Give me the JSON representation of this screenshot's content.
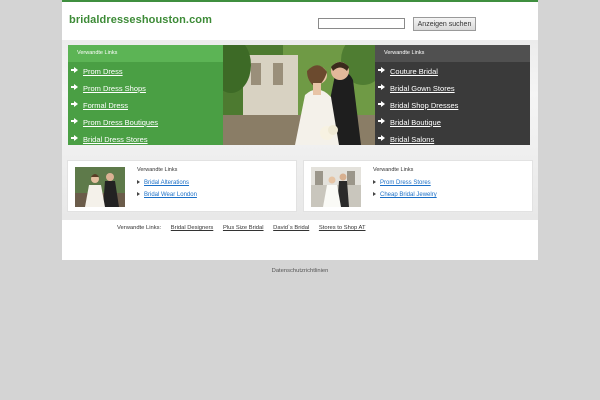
{
  "header": {
    "domain": "bridaldresseshouston.com",
    "search_placeholder": "",
    "search_button": "Anzeigen suchen"
  },
  "left_panel": {
    "heading": "Verwandte Links",
    "links": [
      "Prom Dress",
      "Prom Dress Shops",
      "Formal Dress",
      "Prom Dress Boutiques",
      "Bridal Dress Stores"
    ]
  },
  "right_panel": {
    "heading": "Verwandte Links",
    "links": [
      "Couture Bridal",
      "Bridal Gown Stores",
      "Bridal Shop Dresses",
      "Bridal Boutique",
      "Bridal Salons"
    ]
  },
  "card_left": {
    "heading": "Verwandte Links",
    "links": [
      "Bridal Alterations",
      "Bridal Wear London"
    ]
  },
  "card_right": {
    "heading": "Verwandte Links",
    "links": [
      "Prom Dress Stores",
      "Cheap Bridal Jewelry"
    ]
  },
  "related_bar": {
    "label": "Verwandte Links:",
    "links": [
      "Bridal Designers",
      "Plus Size Bridal",
      "David`s Bridal",
      "Stores to Shop AT"
    ]
  },
  "footer": {
    "privacy": "Datenschutzrichtlinien"
  },
  "colors": {
    "brand_green": "#3d8b37",
    "panel_green": "#4a9f44",
    "panel_dark": "#3a3a3a",
    "link_blue": "#1a6fc7",
    "page_bg": "#d4d4d4"
  }
}
